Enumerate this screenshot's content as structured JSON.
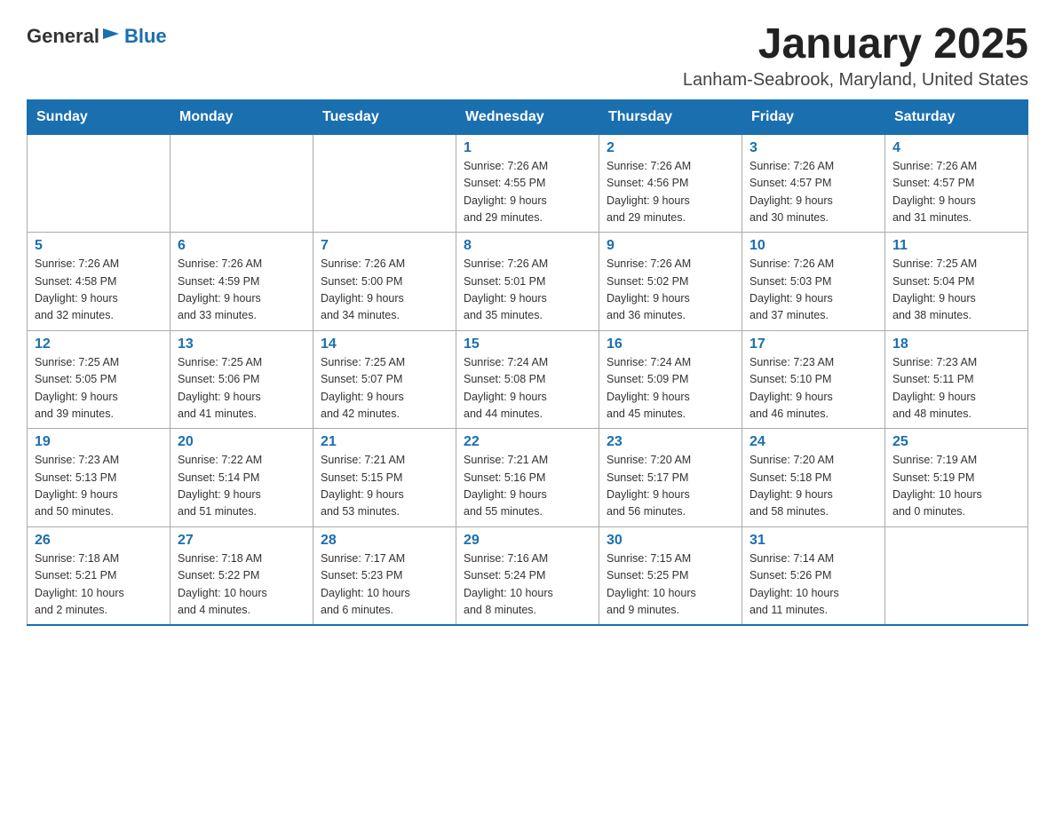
{
  "header": {
    "logo_general": "General",
    "logo_blue": "Blue",
    "month_year": "January 2025",
    "location": "Lanham-Seabrook, Maryland, United States"
  },
  "weekdays": [
    "Sunday",
    "Monday",
    "Tuesday",
    "Wednesday",
    "Thursday",
    "Friday",
    "Saturday"
  ],
  "weeks": [
    [
      {
        "day": "",
        "info": ""
      },
      {
        "day": "",
        "info": ""
      },
      {
        "day": "",
        "info": ""
      },
      {
        "day": "1",
        "info": "Sunrise: 7:26 AM\nSunset: 4:55 PM\nDaylight: 9 hours\nand 29 minutes."
      },
      {
        "day": "2",
        "info": "Sunrise: 7:26 AM\nSunset: 4:56 PM\nDaylight: 9 hours\nand 29 minutes."
      },
      {
        "day": "3",
        "info": "Sunrise: 7:26 AM\nSunset: 4:57 PM\nDaylight: 9 hours\nand 30 minutes."
      },
      {
        "day": "4",
        "info": "Sunrise: 7:26 AM\nSunset: 4:57 PM\nDaylight: 9 hours\nand 31 minutes."
      }
    ],
    [
      {
        "day": "5",
        "info": "Sunrise: 7:26 AM\nSunset: 4:58 PM\nDaylight: 9 hours\nand 32 minutes."
      },
      {
        "day": "6",
        "info": "Sunrise: 7:26 AM\nSunset: 4:59 PM\nDaylight: 9 hours\nand 33 minutes."
      },
      {
        "day": "7",
        "info": "Sunrise: 7:26 AM\nSunset: 5:00 PM\nDaylight: 9 hours\nand 34 minutes."
      },
      {
        "day": "8",
        "info": "Sunrise: 7:26 AM\nSunset: 5:01 PM\nDaylight: 9 hours\nand 35 minutes."
      },
      {
        "day": "9",
        "info": "Sunrise: 7:26 AM\nSunset: 5:02 PM\nDaylight: 9 hours\nand 36 minutes."
      },
      {
        "day": "10",
        "info": "Sunrise: 7:26 AM\nSunset: 5:03 PM\nDaylight: 9 hours\nand 37 minutes."
      },
      {
        "day": "11",
        "info": "Sunrise: 7:25 AM\nSunset: 5:04 PM\nDaylight: 9 hours\nand 38 minutes."
      }
    ],
    [
      {
        "day": "12",
        "info": "Sunrise: 7:25 AM\nSunset: 5:05 PM\nDaylight: 9 hours\nand 39 minutes."
      },
      {
        "day": "13",
        "info": "Sunrise: 7:25 AM\nSunset: 5:06 PM\nDaylight: 9 hours\nand 41 minutes."
      },
      {
        "day": "14",
        "info": "Sunrise: 7:25 AM\nSunset: 5:07 PM\nDaylight: 9 hours\nand 42 minutes."
      },
      {
        "day": "15",
        "info": "Sunrise: 7:24 AM\nSunset: 5:08 PM\nDaylight: 9 hours\nand 44 minutes."
      },
      {
        "day": "16",
        "info": "Sunrise: 7:24 AM\nSunset: 5:09 PM\nDaylight: 9 hours\nand 45 minutes."
      },
      {
        "day": "17",
        "info": "Sunrise: 7:23 AM\nSunset: 5:10 PM\nDaylight: 9 hours\nand 46 minutes."
      },
      {
        "day": "18",
        "info": "Sunrise: 7:23 AM\nSunset: 5:11 PM\nDaylight: 9 hours\nand 48 minutes."
      }
    ],
    [
      {
        "day": "19",
        "info": "Sunrise: 7:23 AM\nSunset: 5:13 PM\nDaylight: 9 hours\nand 50 minutes."
      },
      {
        "day": "20",
        "info": "Sunrise: 7:22 AM\nSunset: 5:14 PM\nDaylight: 9 hours\nand 51 minutes."
      },
      {
        "day": "21",
        "info": "Sunrise: 7:21 AM\nSunset: 5:15 PM\nDaylight: 9 hours\nand 53 minutes."
      },
      {
        "day": "22",
        "info": "Sunrise: 7:21 AM\nSunset: 5:16 PM\nDaylight: 9 hours\nand 55 minutes."
      },
      {
        "day": "23",
        "info": "Sunrise: 7:20 AM\nSunset: 5:17 PM\nDaylight: 9 hours\nand 56 minutes."
      },
      {
        "day": "24",
        "info": "Sunrise: 7:20 AM\nSunset: 5:18 PM\nDaylight: 9 hours\nand 58 minutes."
      },
      {
        "day": "25",
        "info": "Sunrise: 7:19 AM\nSunset: 5:19 PM\nDaylight: 10 hours\nand 0 minutes."
      }
    ],
    [
      {
        "day": "26",
        "info": "Sunrise: 7:18 AM\nSunset: 5:21 PM\nDaylight: 10 hours\nand 2 minutes."
      },
      {
        "day": "27",
        "info": "Sunrise: 7:18 AM\nSunset: 5:22 PM\nDaylight: 10 hours\nand 4 minutes."
      },
      {
        "day": "28",
        "info": "Sunrise: 7:17 AM\nSunset: 5:23 PM\nDaylight: 10 hours\nand 6 minutes."
      },
      {
        "day": "29",
        "info": "Sunrise: 7:16 AM\nSunset: 5:24 PM\nDaylight: 10 hours\nand 8 minutes."
      },
      {
        "day": "30",
        "info": "Sunrise: 7:15 AM\nSunset: 5:25 PM\nDaylight: 10 hours\nand 9 minutes."
      },
      {
        "day": "31",
        "info": "Sunrise: 7:14 AM\nSunset: 5:26 PM\nDaylight: 10 hours\nand 11 minutes."
      },
      {
        "day": "",
        "info": ""
      }
    ]
  ]
}
